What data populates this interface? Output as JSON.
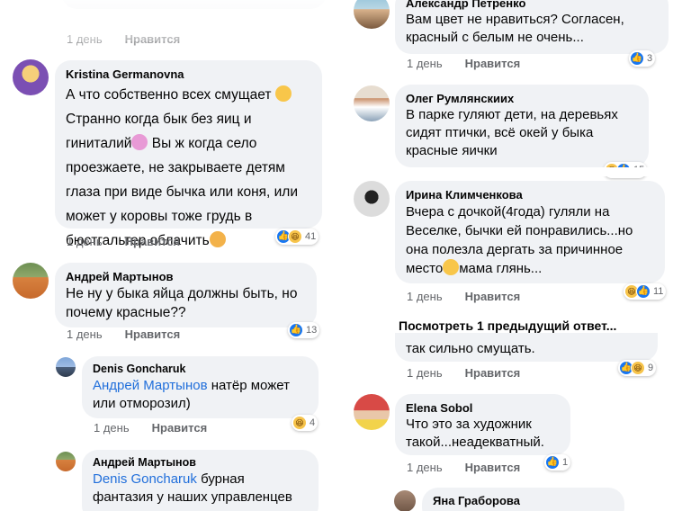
{
  "left_top_partial": {
    "actions": [
      "1 день",
      "Нравится"
    ]
  },
  "left": [
    {
      "author": "Kristina Germanovna",
      "text_lines": [
        "А что собственно всех смущает",
        "Странно когда бык без яиц и",
        "гиниталий",
        " Вы ж когда село",
        "проезжаете, не закрываете детям",
        "глаза при виде бычка или коня, или",
        "может у коровы тоже грудь в",
        "бюстгальтер облачить"
      ],
      "time": "1 день",
      "like": "Нравится",
      "reaction_count": "41",
      "emoji": [
        "flushed-face-emoji",
        "person-emoji",
        "facepalm-emoji"
      ]
    },
    {
      "author": "Андрей Мартынов",
      "text_lines": [
        "Не ну у быка яйца должны быть, но",
        "почему красные??"
      ],
      "time": "1 день",
      "like": "Нравится",
      "reaction_count": "13"
    },
    {
      "author": "Denis Goncharuk",
      "mention": "Андрей Мартынов",
      "mention_rest": " натёр может",
      "text_lines": [
        "или отморозил)"
      ],
      "time": "1 день",
      "like": "Нравится",
      "reaction_count": "4"
    },
    {
      "author": "Андрей Мартынов",
      "mention": "Denis Goncharuk",
      "mention_rest": " бурная",
      "text_lines": [
        "фантазия у наших управленцев"
      ]
    }
  ],
  "right": [
    {
      "author": "Александр Петренко",
      "text_lines": [
        "Вам цвет не нравиться? Согласен,",
        "красный с белым не очень..."
      ],
      "time": "1 день",
      "like": "Нравится",
      "reaction_count": "3"
    },
    {
      "author": "Олег Румлянскиих",
      "text_lines": [
        "В парке гуляют дети, на деревьях",
        "сидят птички, всё окей у быка",
        "красные яички"
      ],
      "reaction_count": "15"
    },
    {
      "author": "Ирина Климченкова",
      "text_lines": [
        "Вчера с дочкой(4года) гуляли на",
        "Веселке, бычки ей понравились...но",
        "она полезла дергать за причинное",
        "место",
        "мама глянь..."
      ],
      "time": "1 день",
      "like": "Нравится",
      "reaction_count": "11"
    },
    {
      "view_previous": "Посмотреть 1 предыдущий ответ...",
      "text_lines": [
        "так сильно смущать."
      ],
      "time": "1 день",
      "like": "Нравится",
      "reaction_count": "9"
    },
    {
      "author": "Elena Sobol",
      "text_lines": [
        "Что это за художник",
        "такой...неадекватный."
      ],
      "time": "1 день",
      "like": "Нравится",
      "reaction_count": "1"
    },
    {
      "author": "Яна Граборова"
    }
  ]
}
